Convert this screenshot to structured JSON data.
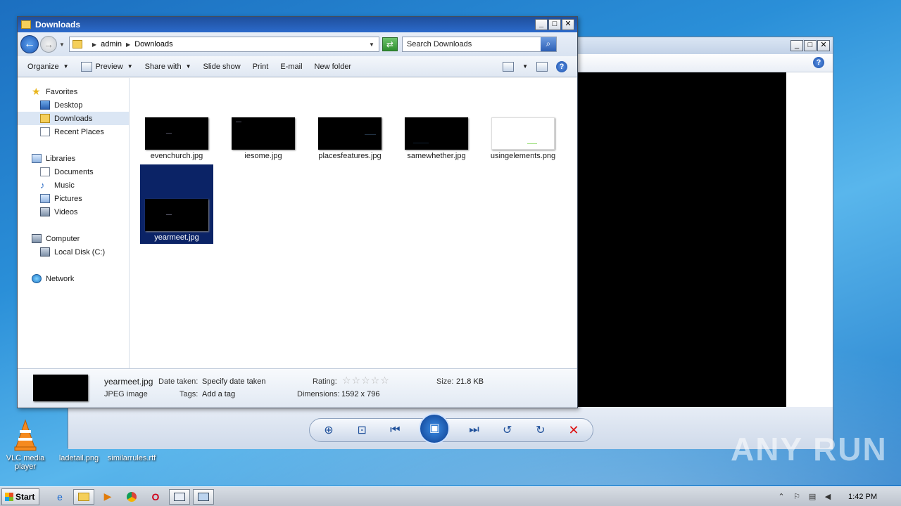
{
  "desktop": {
    "icons": [
      {
        "label": "VLC media player"
      },
      {
        "label": "ladetail.png"
      },
      {
        "label": "similarrules.rtf"
      }
    ],
    "watermark": "ANY RUN"
  },
  "explorer": {
    "title": "Downloads",
    "breadcrumb": [
      "admin",
      "Downloads"
    ],
    "search_placeholder": "Search Downloads",
    "toolbar": {
      "organize": "Organize",
      "preview": "Preview",
      "share_with": "Share with",
      "slide_show": "Slide show",
      "print": "Print",
      "email": "E-mail",
      "new_folder": "New folder"
    },
    "nav": {
      "favorites": "Favorites",
      "desktop": "Desktop",
      "downloads": "Downloads",
      "recent_places": "Recent Places",
      "libraries": "Libraries",
      "documents": "Documents",
      "music": "Music",
      "pictures": "Pictures",
      "videos": "Videos",
      "computer": "Computer",
      "local_disk": "Local Disk (C:)",
      "network": "Network"
    },
    "files": [
      {
        "name": "evenchurch.jpg"
      },
      {
        "name": "iesome.jpg"
      },
      {
        "name": "placesfeatures.jpg"
      },
      {
        "name": "samewhether.jpg"
      },
      {
        "name": "usingelements.png"
      },
      {
        "name": "yearmeet.jpg",
        "selected": true
      }
    ],
    "details": {
      "filename": "yearmeet.jpg",
      "filetype": "JPEG image",
      "date_taken_label": "Date taken:",
      "date_taken_value": "Specify date taken",
      "tags_label": "Tags:",
      "tags_value": "Add a tag",
      "rating_label": "Rating:",
      "rating_value": 0,
      "dimensions_label": "Dimensions:",
      "dimensions_value": "1592 x 796",
      "size_label": "Size:",
      "size_value": "21.8 KB"
    }
  },
  "taskbar": {
    "start": "Start",
    "clock": "1:42 PM"
  }
}
